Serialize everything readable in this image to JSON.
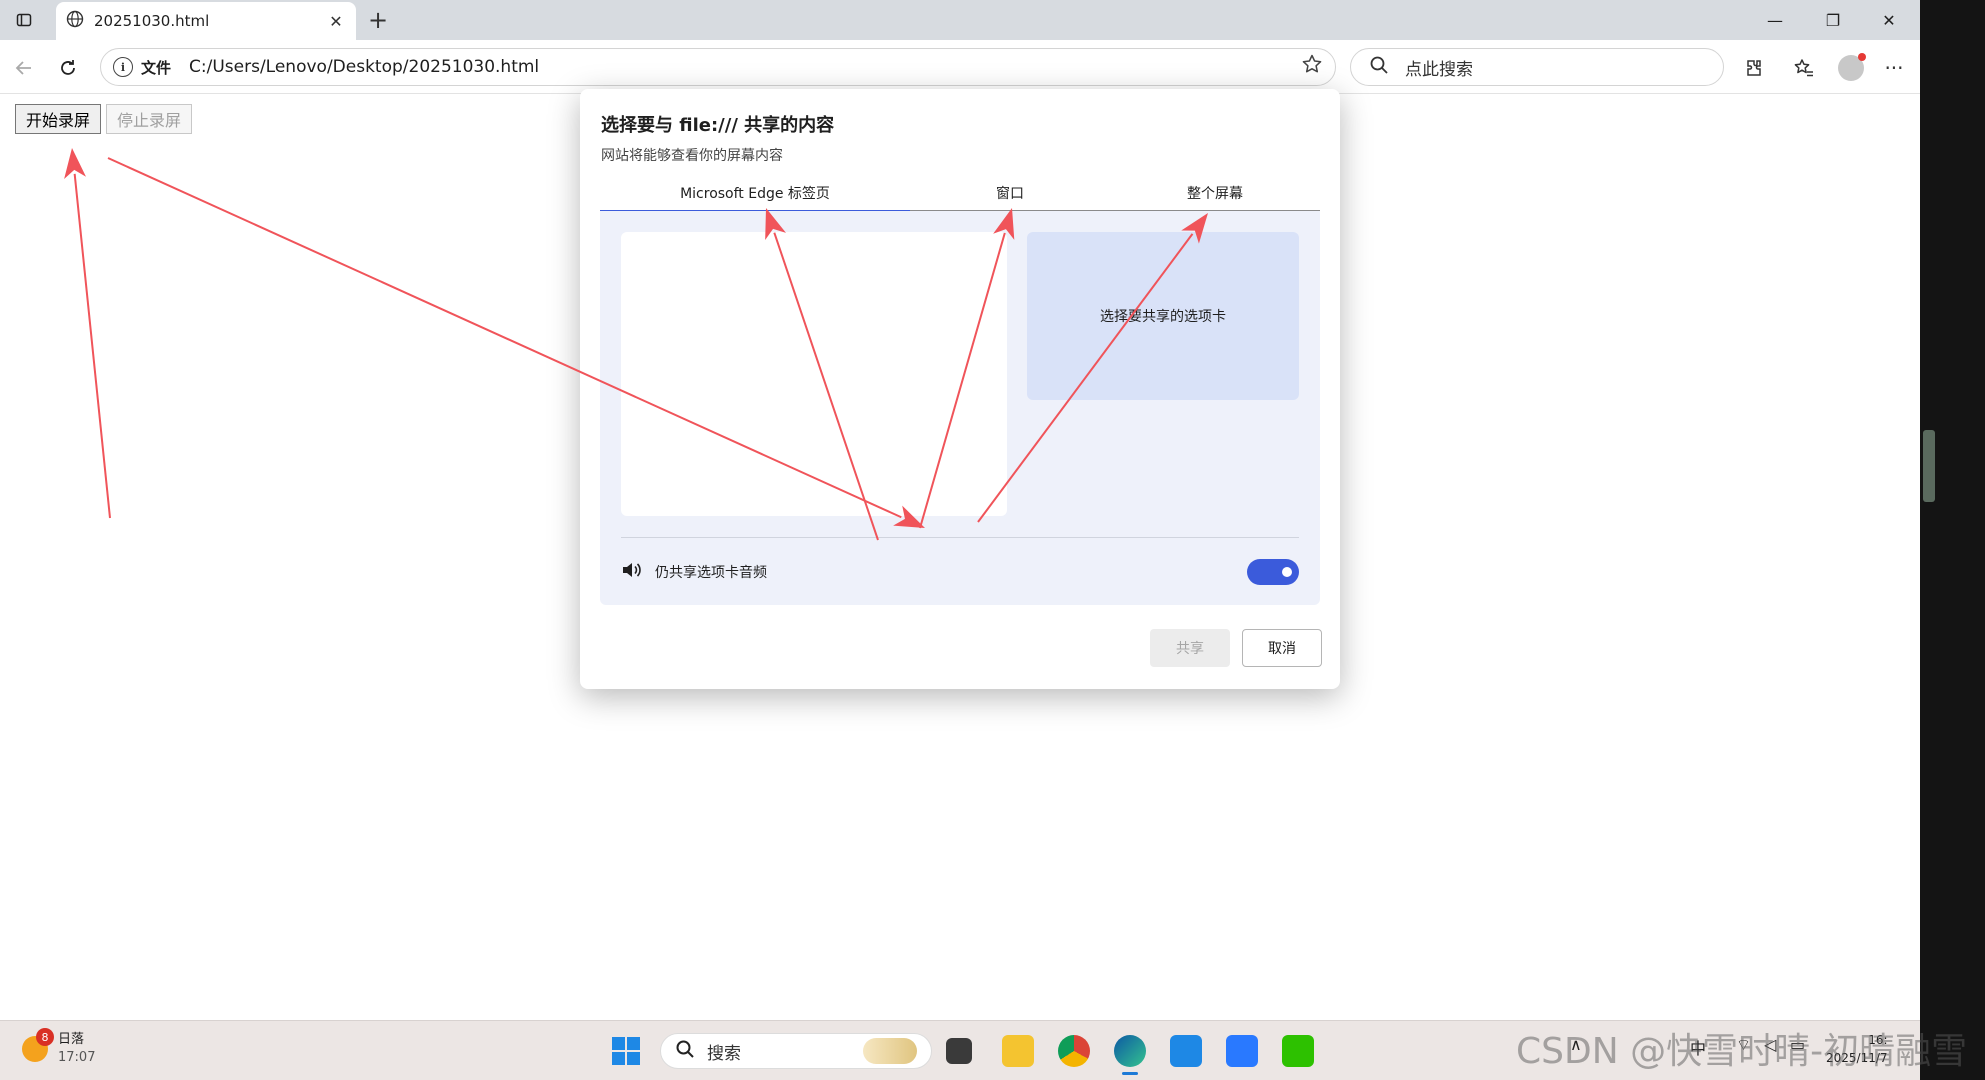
{
  "browser": {
    "tab_title": "20251030.html",
    "tab_close": "✕",
    "new_tab": "+",
    "window_controls": {
      "minimize": "—",
      "restore": "❐",
      "close": "✕"
    },
    "address": {
      "scheme_label": "文件",
      "url": "C:/Users/Lenovo/Desktop/20251030.html",
      "info_glyph": "i"
    },
    "search": {
      "placeholder": "点此搜索"
    },
    "menu_glyph": "···"
  },
  "page": {
    "start_button": "开始录屏",
    "stop_button": "停止录屏"
  },
  "dialog": {
    "title": "选择要与 file:/// 共享的内容",
    "subtitle": "网站将能够查看你的屏幕内容",
    "tabs": [
      {
        "label": "Microsoft Edge 标签页",
        "active": true
      },
      {
        "label": "窗口",
        "active": false
      },
      {
        "label": "整个屏幕",
        "active": false
      }
    ],
    "preview_text": "选择要共享的选项卡",
    "audio_label": "仍共享选项卡音频",
    "audio_enabled": true,
    "share_button": "共享",
    "cancel_button": "取消"
  },
  "annotation_color": "#f0545a",
  "taskbar": {
    "weather_badge": "8",
    "weather_label": "日落",
    "weather_time": "17:07",
    "search_placeholder": "搜索",
    "tray_ime": "中",
    "clock_time": "16:",
    "clock_date": "2025/11/7",
    "watermark": "CSDN @快雪时晴-初晴融雪"
  }
}
